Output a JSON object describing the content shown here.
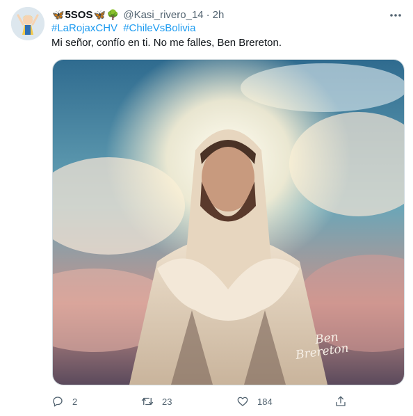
{
  "tweet": {
    "author": {
      "name": "5SOS",
      "name_glyphs": [
        "🦋",
        "🦋",
        "🌳"
      ],
      "handle": "@Kasi_rivero_14",
      "separator": "·",
      "time": "2h"
    },
    "hashtags": [
      "#LaRojaxCHV",
      "#ChileVsBolivia"
    ],
    "text": "Mi señor, confío en ti. No me falles, Ben Brereton.",
    "media": {
      "signature": [
        "Ben",
        "Brereton"
      ]
    },
    "actions": {
      "reply_count": "2",
      "retweet_count": "23",
      "like_count": "184"
    },
    "icons": {
      "more": "more-dots-icon",
      "reply": "reply-icon",
      "retweet": "retweet-icon",
      "like": "like-icon",
      "share": "share-icon"
    },
    "colors": {
      "link": "#1d9bf0",
      "muted": "#536471",
      "text": "#0f1419"
    }
  }
}
